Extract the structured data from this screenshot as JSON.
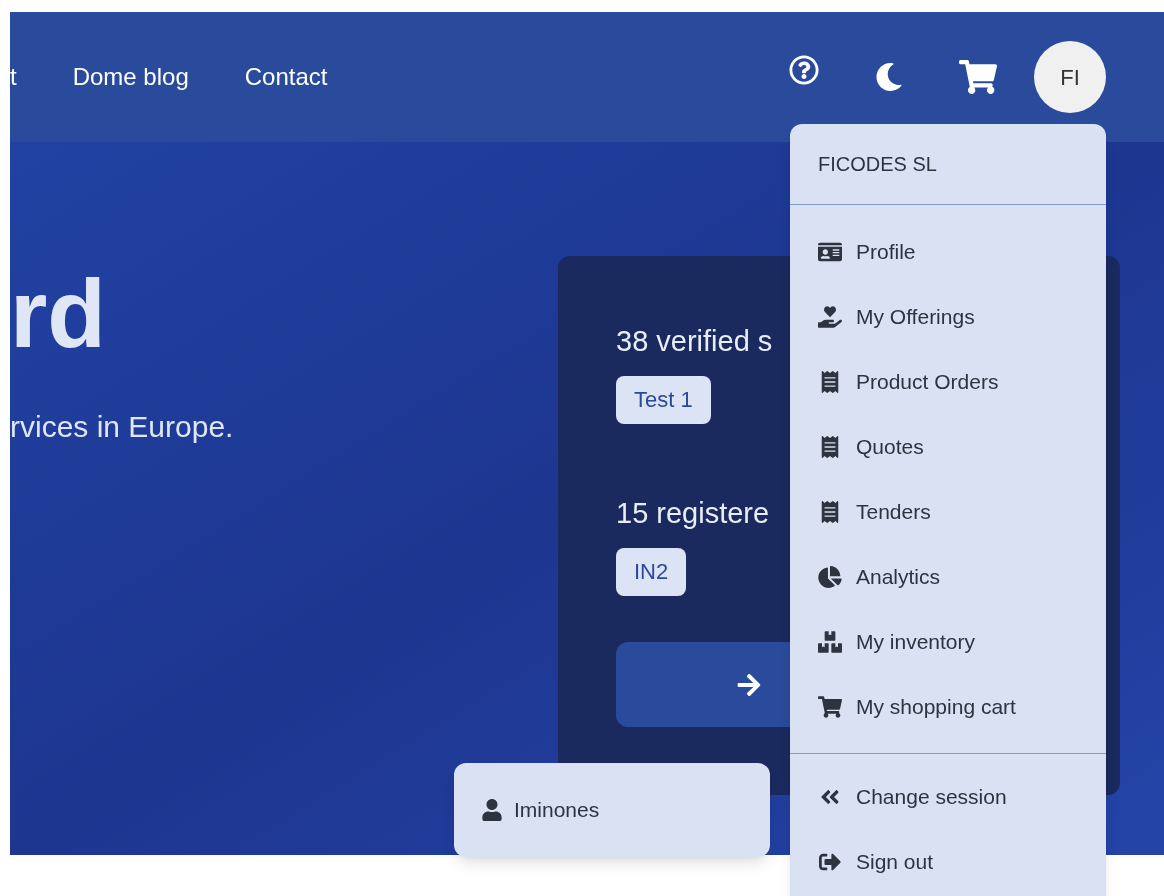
{
  "nav": {
    "links": [
      {
        "label": "t"
      },
      {
        "label": "Dome blog"
      },
      {
        "label": "Contact"
      }
    ],
    "avatar": "FI"
  },
  "hero": {
    "title": "rd",
    "subtitle": "rvices in Europe."
  },
  "stats_card": {
    "stats": [
      {
        "text": "38 verified s",
        "tag": "Test 1"
      },
      {
        "text": "15 registere",
        "tag": "IN2"
      }
    ]
  },
  "account_menu": {
    "company": "FICODES SL",
    "groups": [
      [
        {
          "label": "Profile"
        },
        {
          "label": "My Offerings"
        },
        {
          "label": "Product Orders"
        },
        {
          "label": "Quotes"
        },
        {
          "label": "Tenders"
        },
        {
          "label": "Analytics"
        },
        {
          "label": "My inventory"
        },
        {
          "label": "My shopping cart"
        }
      ],
      [
        {
          "label": "Change session"
        },
        {
          "label": "Sign out"
        }
      ]
    ]
  },
  "session_popup": {
    "user": "Iminones"
  }
}
